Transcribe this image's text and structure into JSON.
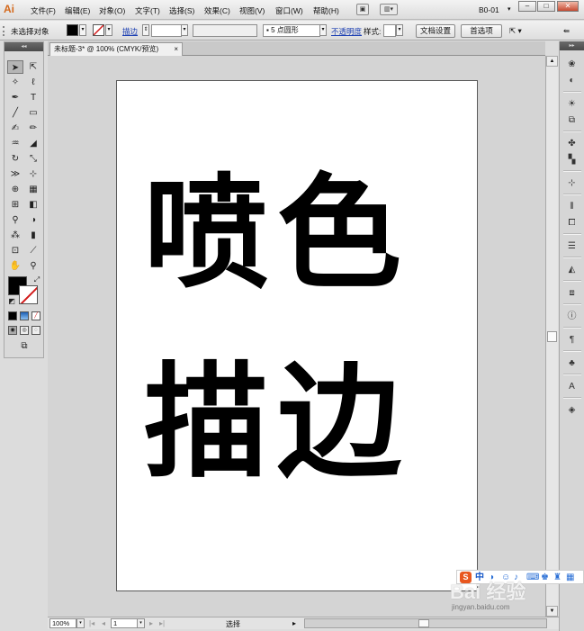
{
  "app": {
    "logo": "Ai",
    "workspace": "B0-01"
  },
  "menu": [
    "文件(F)",
    "编辑(E)",
    "对象(O)",
    "文字(T)",
    "选择(S)",
    "效果(C)",
    "视图(V)",
    "窗口(W)",
    "帮助(H)"
  ],
  "window_buttons": {
    "minimize": "–",
    "maximize": "□",
    "close": "✕"
  },
  "controlbar": {
    "selection_status": "未选择对象",
    "stroke_label": "描边",
    "brush_value": "5 点圆形",
    "opacity_label": "不透明度",
    "style_label": "样式:",
    "doc_setup_button": "文档设置",
    "prefs_button": "首选项"
  },
  "document": {
    "tab_title": "未标题-3* @ 100% (CMYK/预览)",
    "tab_close": "×",
    "line1": "喷色",
    "line2": "描边"
  },
  "statusbar": {
    "zoom": "100%",
    "page": "1",
    "tool_status": "选择"
  },
  "ime": {
    "logo": "S",
    "label": "中"
  },
  "watermark": {
    "text": "Bai 经验",
    "url": "jingyan.baidu.com"
  },
  "colors": {
    "fill": "#000000",
    "stroke_none": "#d21a1a",
    "logo": "#d4691c",
    "artboard": "#ffffff"
  }
}
